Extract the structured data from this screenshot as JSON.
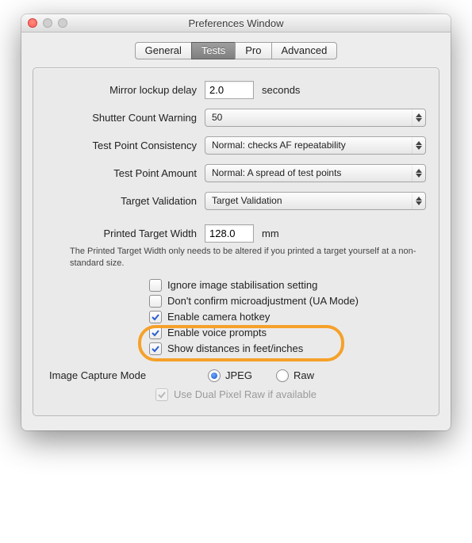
{
  "window": {
    "title": "Preferences Window"
  },
  "tabs": {
    "items": [
      {
        "label": "General"
      },
      {
        "label": "Tests"
      },
      {
        "label": "Pro"
      },
      {
        "label": "Advanced"
      }
    ],
    "active_index": 1
  },
  "fields": {
    "mirror_lockup": {
      "label": "Mirror lockup delay",
      "value": "2.0",
      "unit": "seconds"
    },
    "shutter_warning": {
      "label": "Shutter Count Warning",
      "value": "50"
    },
    "consistency": {
      "label": "Test Point Consistency",
      "value": "Normal: checks AF repeatability"
    },
    "amount": {
      "label": "Test Point Amount",
      "value": "Normal: A spread of test points"
    },
    "target_validation": {
      "label": "Target Validation",
      "value": "Target Validation"
    },
    "printed_width": {
      "label": "Printed Target Width",
      "value": "128.0",
      "unit": "mm"
    },
    "printed_note": "The Printed Target Width only needs to be altered if you printed a target yourself at a non-standard size."
  },
  "checks": {
    "ignore_is": {
      "label": "Ignore image stabilisation setting",
      "checked": false
    },
    "dont_confirm": {
      "label": "Don't confirm microadjustment (UA Mode)",
      "checked": false
    },
    "hotkey": {
      "label": "Enable camera hotkey",
      "checked": true
    },
    "voice": {
      "label": "Enable voice prompts",
      "checked": true
    },
    "feet": {
      "label": "Show distances in feet/inches",
      "checked": true
    }
  },
  "capture": {
    "label": "Image Capture Mode",
    "jpeg": "JPEG",
    "raw": "Raw",
    "selected": "jpeg",
    "dual_pixel": {
      "label": "Use Dual Pixel Raw if available",
      "checked": true,
      "enabled": false
    }
  }
}
